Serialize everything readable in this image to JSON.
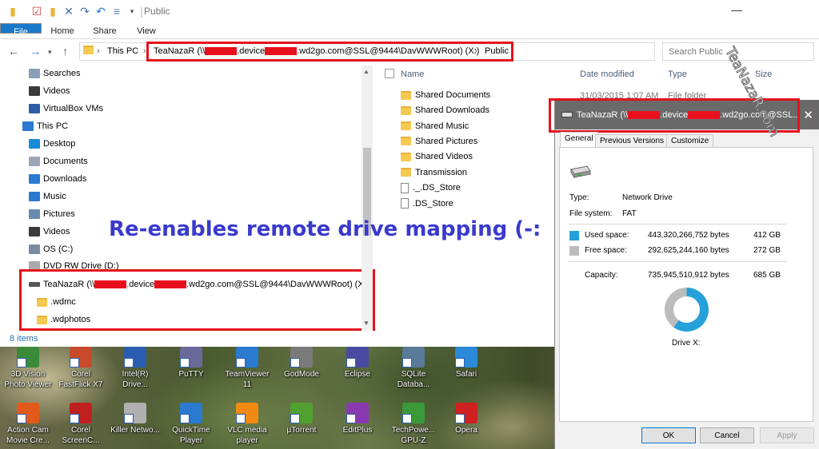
{
  "window": {
    "title": "Public",
    "tabs": [
      "File",
      "Home",
      "Share",
      "View"
    ]
  },
  "address": {
    "this_pc": "This PC",
    "drive_prefix": "TeaNazaR (\\\\",
    "drive_mid1": ".device",
    "drive_mid2": ".wd2go.com@SSL@9444\\DavWWWRoot) (X:)",
    "current": "Public"
  },
  "search": {
    "placeholder": "Search Public"
  },
  "nav": {
    "items": [
      {
        "label": "Searches",
        "icon": "search-icon"
      },
      {
        "label": "Videos",
        "icon": "videos-icon"
      },
      {
        "label": "VirtualBox VMs",
        "icon": "virtualbox-icon"
      },
      {
        "label": "This PC",
        "icon": "computer-icon"
      },
      {
        "label": "Desktop",
        "icon": "desktop-icon"
      },
      {
        "label": "Documents",
        "icon": "documents-icon"
      },
      {
        "label": "Downloads",
        "icon": "downloads-icon"
      },
      {
        "label": "Music",
        "icon": "music-icon"
      },
      {
        "label": "Pictures",
        "icon": "pictures-icon"
      },
      {
        "label": "Videos",
        "icon": "videos-icon"
      },
      {
        "label": "OS (C:)",
        "icon": "drive-icon"
      },
      {
        "label": "DVD RW Drive (D:)",
        "icon": "dvd-icon"
      }
    ],
    "network_drive": {
      "prefix": "TeaNazaR (\\\\",
      "mid1": ".device",
      "mid2": ".wd2go.com@SSL@9444\\DavWWWRoot) (X:)"
    },
    "subfolders": [
      ".wdmc",
      ".wdphotos"
    ]
  },
  "content": {
    "columns": {
      "name": "Name",
      "date": "Date modified",
      "type": "Type",
      "size": "Size"
    },
    "first_row_date": "31/03/2015 1:07 AM",
    "first_row_type": "File folder",
    "files": [
      {
        "name": "Shared Documents",
        "kind": "folder"
      },
      {
        "name": "Shared Downloads",
        "kind": "folder"
      },
      {
        "name": "Shared Music",
        "kind": "folder"
      },
      {
        "name": "Shared Pictures",
        "kind": "folder"
      },
      {
        "name": "Shared Videos",
        "kind": "folder"
      },
      {
        "name": "Transmission",
        "kind": "folder"
      },
      {
        "name": "._.DS_Store",
        "kind": "file"
      },
      {
        "name": ".DS_Store",
        "kind": "file"
      }
    ]
  },
  "status": {
    "items": "8 items"
  },
  "caption": "Re-enables remote drive mapping (-:",
  "watermark": "TeaNazaR.com",
  "props": {
    "title_prefix": "TeaNazaR (\\\\",
    "title_mid1": ".device",
    "title_mid2": ".wd2go.com@SSL...",
    "tabs": [
      "General",
      "Previous Versions",
      "Customize"
    ],
    "type_label": "Type:",
    "type_value": "Network Drive",
    "fs_label": "File system:",
    "fs_value": "FAT",
    "used_label": "Used space:",
    "used_bytes": "443,320,266,752 bytes",
    "used_gb": "412 GB",
    "free_label": "Free space:",
    "free_bytes": "292,625,244,160 bytes",
    "free_gb": "272 GB",
    "cap_label": "Capacity:",
    "cap_bytes": "735,945,510,912 bytes",
    "cap_gb": "685 GB",
    "drive_label": "Drive X:",
    "used_fraction": 0.6,
    "buttons": {
      "ok": "OK",
      "cancel": "Cancel",
      "apply": "Apply"
    },
    "colors": {
      "used": "#26a0da",
      "free": "#bcbcbc"
    }
  },
  "desktop": {
    "icons_row1": [
      "3D Vision Photo Viewer",
      "Corel FastFlick X7",
      "Intel(R) Drive...",
      "PuTTY",
      "TeamViewer 11",
      "GodMode",
      "Eclipse",
      "SQLite Databa...",
      "Safari"
    ],
    "icons_row2": [
      "Action Cam Movie Cre...",
      "Corel ScreenC...",
      "Killer Netwo...",
      "QuickTime Player",
      "VLC media player",
      "µTorrent",
      "EditPlus",
      "TechPowe... GPU-Z",
      "Opera"
    ]
  }
}
